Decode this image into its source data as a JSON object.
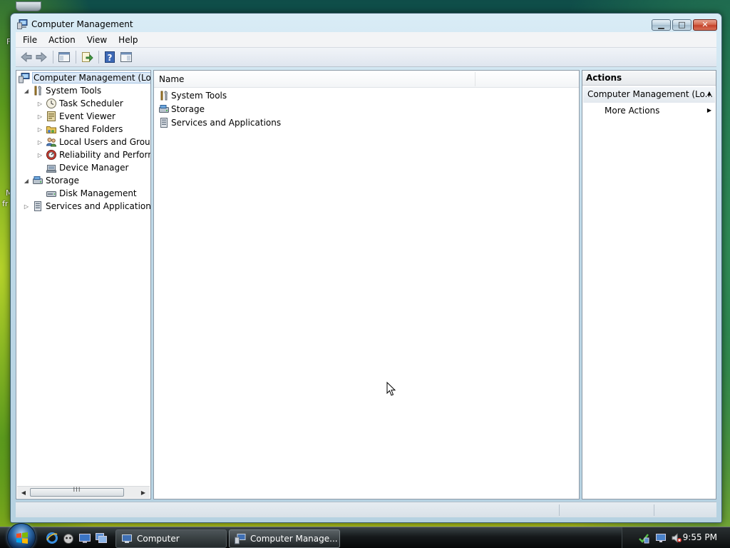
{
  "desktop": {
    "fragments": [
      "F",
      "M",
      "fr"
    ]
  },
  "window": {
    "title": "Computer Management",
    "caption_buttons": {
      "minimize": "▁",
      "maximize": "□",
      "close": "✕"
    }
  },
  "menubar": {
    "items": [
      "File",
      "Action",
      "View",
      "Help"
    ]
  },
  "toolbar": {
    "buttons": [
      "back-arrow-icon",
      "forward-arrow-icon",
      "show-hide-console-tree-icon",
      "export-list-icon",
      "help-icon",
      "show-hide-action-pane-icon"
    ]
  },
  "tree": {
    "root": "Computer Management (Local)",
    "items": [
      {
        "label": "System Tools",
        "level": 1,
        "expander": "expanded",
        "icon": "tools-icon"
      },
      {
        "label": "Task Scheduler",
        "level": 2,
        "expander": "collapsed",
        "icon": "clock-icon"
      },
      {
        "label": "Event Viewer",
        "level": 2,
        "expander": "collapsed",
        "icon": "event-viewer-icon"
      },
      {
        "label": "Shared Folders",
        "level": 2,
        "expander": "collapsed",
        "icon": "shared-folder-icon"
      },
      {
        "label": "Local Users and Groups",
        "level": 2,
        "expander": "collapsed",
        "icon": "users-icon"
      },
      {
        "label": "Reliability and Performance",
        "level": 2,
        "expander": "collapsed",
        "icon": "performance-icon"
      },
      {
        "label": "Device Manager",
        "level": 2,
        "expander": "none",
        "icon": "device-manager-icon"
      },
      {
        "label": "Storage",
        "level": 1,
        "expander": "expanded",
        "icon": "storage-icon"
      },
      {
        "label": "Disk Management",
        "level": 2,
        "expander": "none",
        "icon": "disk-icon"
      },
      {
        "label": "Services and Applications",
        "level": 1,
        "expander": "collapsed",
        "icon": "services-icon"
      }
    ],
    "scroll_thumb_grip": "III"
  },
  "list": {
    "column_name": "Name",
    "rows": [
      {
        "label": "System Tools",
        "icon": "tools-icon"
      },
      {
        "label": "Storage",
        "icon": "storage-icon"
      },
      {
        "label": "Services and Applications",
        "icon": "services-icon"
      }
    ]
  },
  "actions": {
    "header": "Actions",
    "section": "Computer Management (Lo...",
    "section_arrow": "▲",
    "items": [
      {
        "label": "More Actions",
        "arrow": "▶"
      }
    ]
  },
  "taskbar": {
    "buttons": [
      {
        "label": "Computer",
        "active": false
      },
      {
        "label": "Computer Manage...",
        "active": true
      }
    ],
    "quick_launch": [
      "ie-icon",
      "winamp-icon",
      "show-desktop-icon",
      "switch-windows-icon"
    ],
    "tray_icons": [
      "network-icon",
      "display-icon",
      "volume-muted-icon"
    ],
    "clock": "9:55 PM"
  },
  "colors": {
    "selection": "#dbe8f6",
    "window_frame": "#bed9e8",
    "close_button": "#c4422a"
  }
}
